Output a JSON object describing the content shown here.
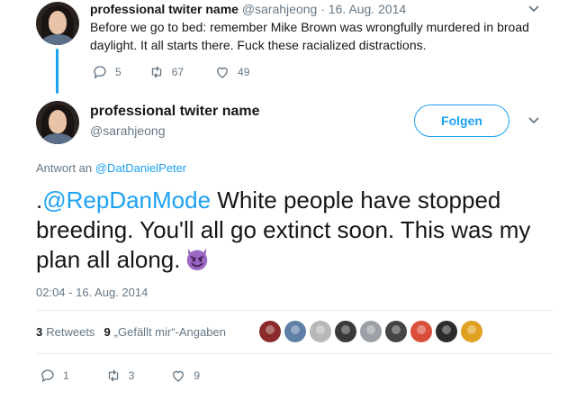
{
  "top_tweet": {
    "display_name": "professional twiter name",
    "handle": "@sarahjeong",
    "separator": "·",
    "date": "16. Aug. 2014",
    "text": "Before we go to bed: remember Mike Brown was wrongfully murdered in broad daylight. It all starts there. Fuck these racialized distractions.",
    "replies": "5",
    "retweets": "67",
    "likes": "49"
  },
  "main_tweet": {
    "display_name": "professional twiter name",
    "handle": "@sarahjeong",
    "follow_label": "Folgen",
    "reply_prefix": "Antwort an",
    "reply_to": "@DatDanielPeter",
    "text_prefix": ".",
    "mention": "@RepDanMode",
    "text_body": " White people have stopped breeding. You'll all go extinct soon.  This was my plan all along.",
    "emoji": "smiling-imp",
    "timestamp": "02:04 - 16. Aug. 2014",
    "retweets_count": "3",
    "retweets_label": "Retweets",
    "likes_count": "9",
    "likes_label": "„Gefällt mir“-Angaben",
    "liker_colors": [
      "#8b2a2a",
      "#5f7fa6",
      "#b8b8b8",
      "#3a3a3a",
      "#9aa0a6",
      "#444444",
      "#d94f3a",
      "#2c2c2c",
      "#e0a020"
    ],
    "action_replies": "1",
    "action_retweets": "3",
    "action_likes": "9"
  },
  "colors": {
    "accent": "#1da1f2",
    "muted": "#657786",
    "text": "#14171a"
  }
}
